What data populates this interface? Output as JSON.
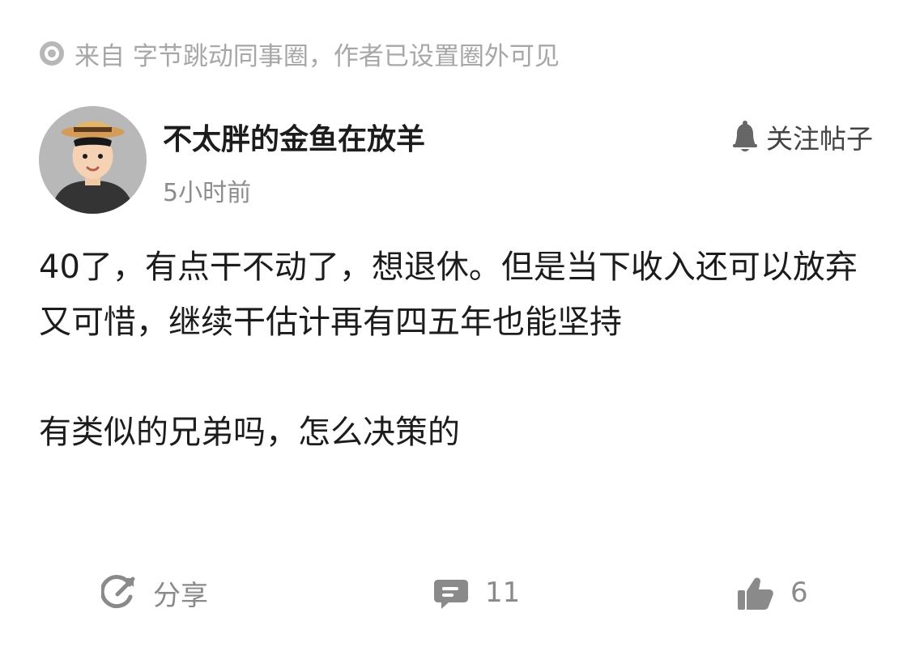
{
  "source": {
    "icon": "circle-dot-icon",
    "text": "来自 字节跳动同事圈，作者已设置圈外可见"
  },
  "author": {
    "avatar": "avatar-straw-hat-man",
    "name": "不太胖的金鱼在放羊",
    "time": "5小时前",
    "follow_label": "关注帖子",
    "follow_icon": "bell-icon"
  },
  "post": {
    "paragraphs": [
      "40了，有点干不动了，想退休。但是当下收入还可以放弃又可惜，继续干估计再有四五年也能坚持",
      "有类似的兄弟吗，怎么决策的"
    ]
  },
  "actions": {
    "share_label": "分享",
    "comment_count": "11",
    "like_count": "6"
  },
  "colors": {
    "text_primary": "#1c1c1c",
    "text_secondary": "#8c8c8c",
    "source_gray": "#a7a7a7",
    "icon_gray": "#8a8a8a",
    "avatar_bg": "#b8b8b8"
  }
}
